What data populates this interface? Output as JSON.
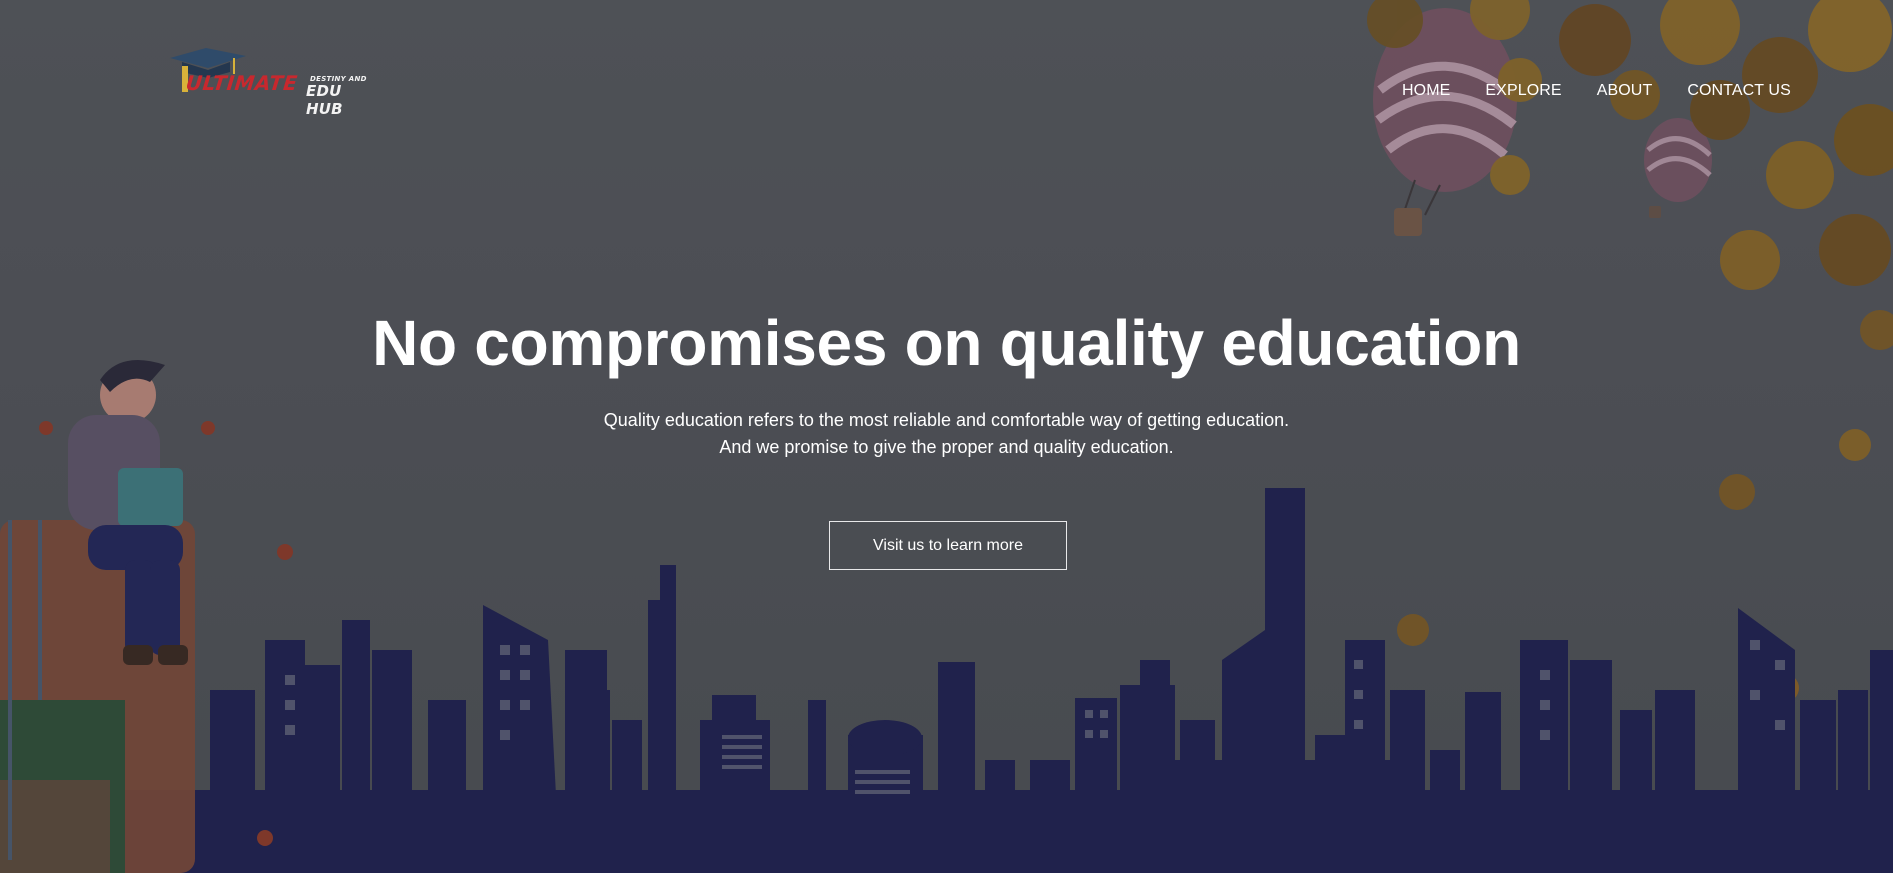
{
  "brand": {
    "logo_wordmark": "ULTIMATE",
    "logo_tagline_small": "DESTINY AND",
    "logo_tagline_large": "EDU HUB",
    "logo_icon": "graduation-cap-icon",
    "accent_color": "#c8282e"
  },
  "nav": {
    "items": [
      {
        "label": "HOME"
      },
      {
        "label": "EXPLORE"
      },
      {
        "label": "ABOUT"
      },
      {
        "label": "CONTACT US"
      }
    ]
  },
  "hero": {
    "headline": "No compromises on quality education",
    "subtext_line_1": "Quality education refers to the most reliable and comfortable way of getting education.",
    "subtext_line_2": "And we promise to give the proper and quality education.",
    "cta_label": "Visit us to learn more",
    "skyline_color": "#1f2150",
    "background_color": "#505357"
  }
}
